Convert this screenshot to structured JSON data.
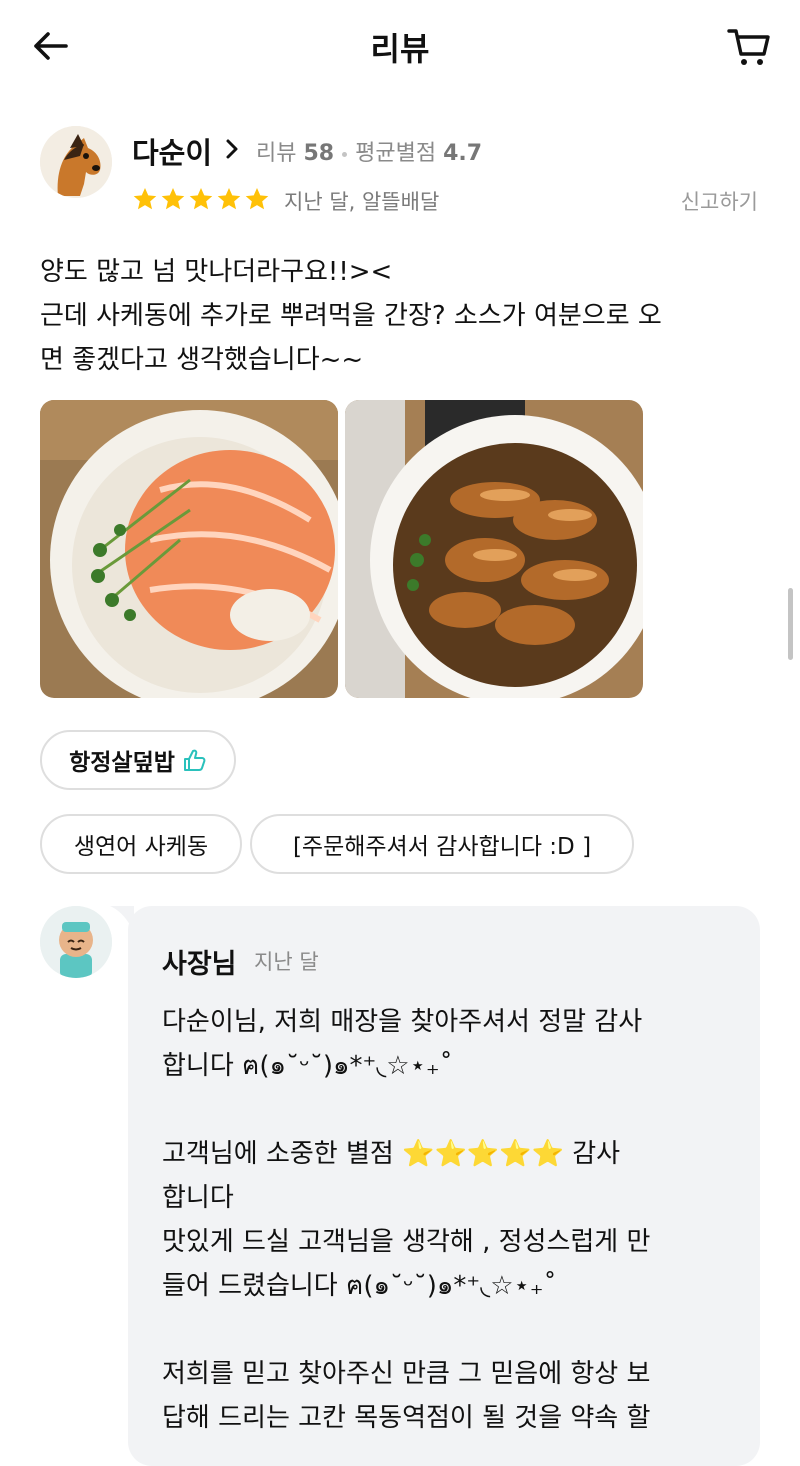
{
  "header": {
    "title": "리뷰",
    "back_icon": "arrow-left-icon",
    "cart_icon": "cart-icon"
  },
  "review": {
    "reviewer_name": "다순이",
    "review_count_label": "리뷰",
    "review_count": "58",
    "avg_rating_label": "평균별점",
    "avg_rating": "4.7",
    "rating": 5,
    "when": "지난 달, 알뜰배달",
    "report_label": "신고하기",
    "text_lines": [
      "양도 많고 넘 맛나더라구요!!><",
      "근데 사케동에 추가로 뿌려먹을 간장? 소스가 여분으로 오",
      "면 좋겠다고 생각했습니다~~"
    ],
    "photos": [
      "salmon-bowl-photo",
      "pork-belly-bowl-photo"
    ],
    "menu_chips": [
      {
        "label": "항정살덮밥",
        "liked": true
      },
      {
        "label": "생연어 사케동",
        "liked": false
      },
      {
        "label": "[주문해주셔서 감사합니다 :D ]",
        "liked": false
      }
    ]
  },
  "owner_reply": {
    "name": "사장님",
    "when": "지난 달",
    "lines": [
      "다순이님, 저희 매장을 찾아주셔서 정말 감사",
      "합니다 ฅ(๑˘ᵕ˘)๑*⁺◟☆⋆₊˚",
      "",
      "고객님에 소중한 별점 ⭐⭐⭐⭐⭐ 감사",
      "합니다",
      "맛있게 드실 고객님을 생각해 , 정성스럽게 만",
      "들어 드렸습니다 ฅ(๑˘ᵕ˘)๑*⁺◟☆⋆₊˚",
      "",
      "저희를 믿고 찾아주신 만큼 그 믿음에 항상 보",
      "답해 드리는 고칸 목동역점이 될 것을 약속 할"
    ]
  },
  "colors": {
    "star": "#FFC107",
    "like": "#2AC1BC",
    "bubble": "#F2F3F5"
  }
}
